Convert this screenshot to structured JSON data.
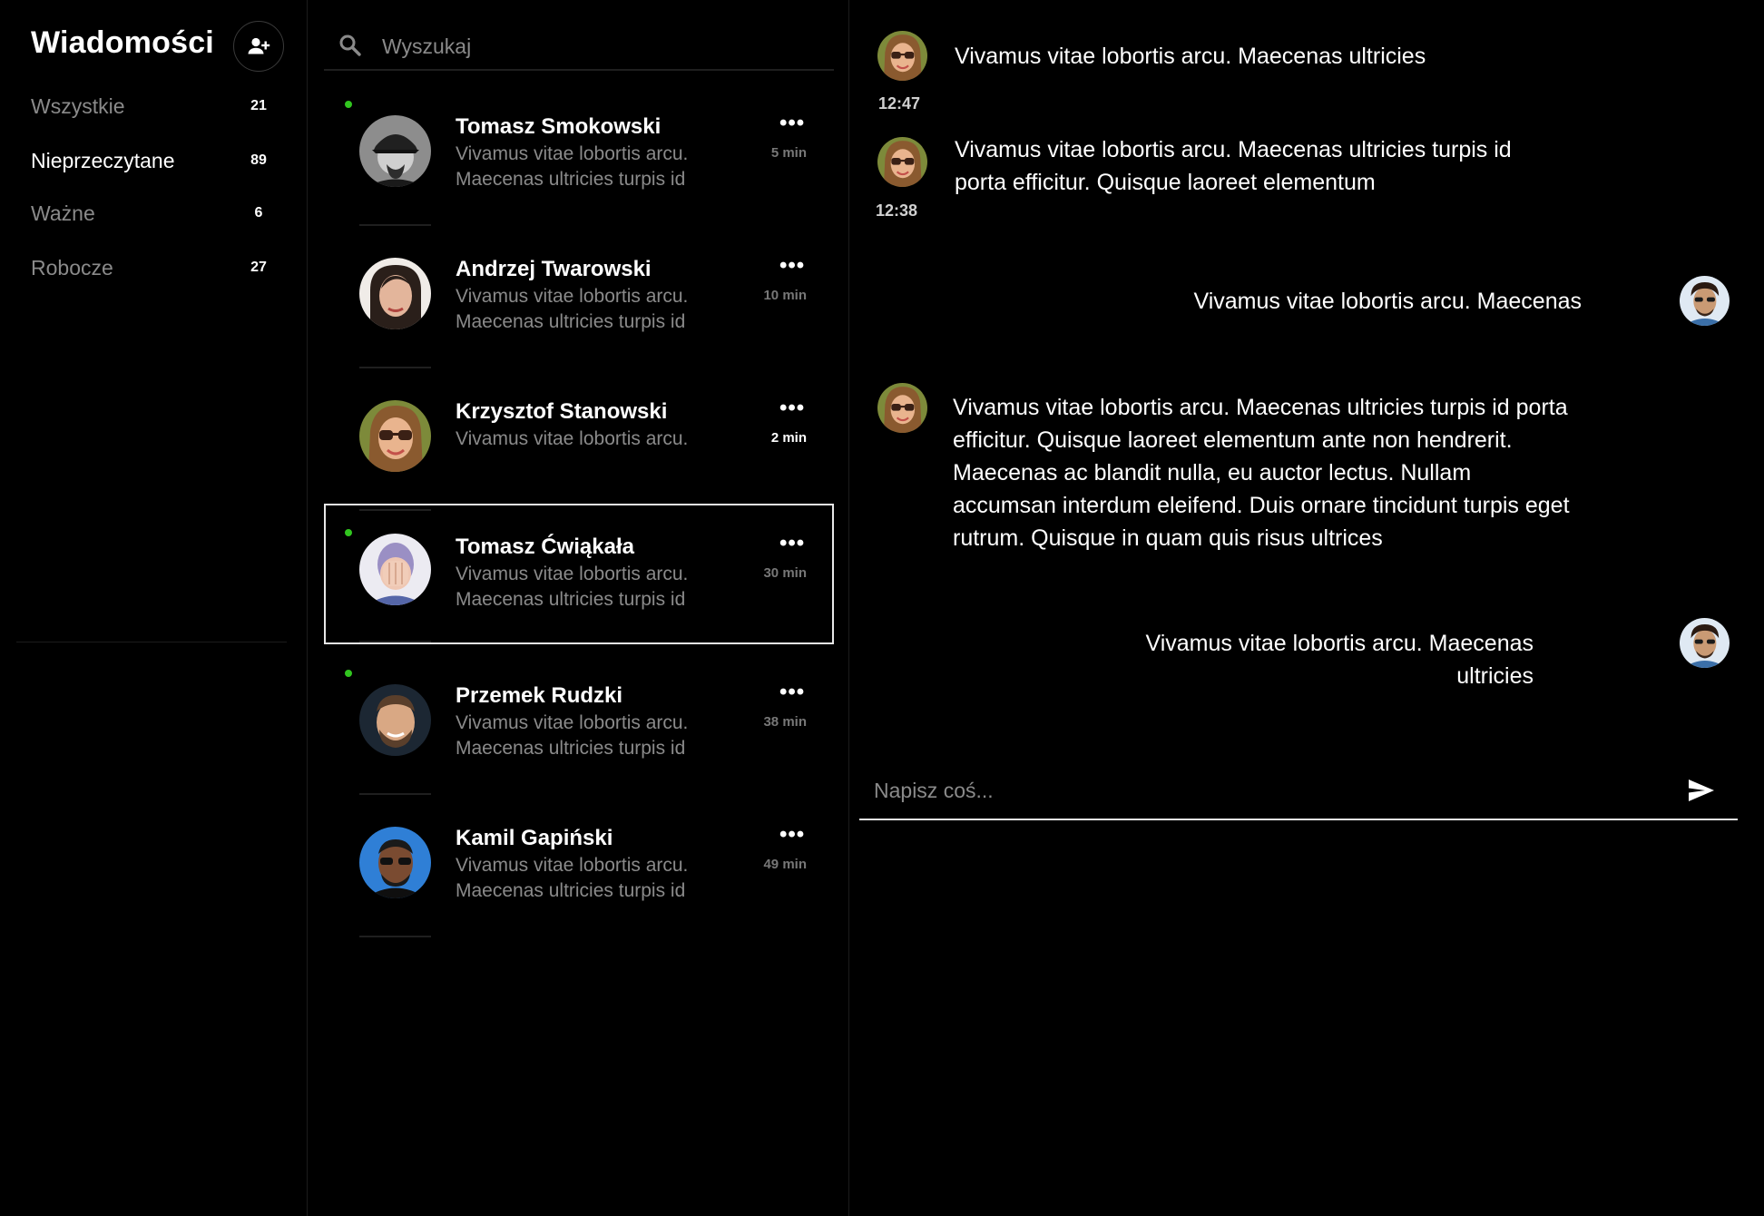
{
  "sidebar": {
    "title": "Wiadomości",
    "add_contact_icon": "person-add-icon",
    "folders": [
      {
        "label": "Wszystkie",
        "count": "21"
      },
      {
        "label": "Nieprzeczytane",
        "count": "89"
      },
      {
        "label": "Ważne",
        "count": "6"
      },
      {
        "label": "Robocze",
        "count": "27"
      }
    ]
  },
  "search": {
    "placeholder": "Wyszukaj",
    "icon": "search-icon"
  },
  "conversations": [
    {
      "name": "Tomasz Smokowski",
      "preview": "Vivamus vitae lobortis arcu. Maecenas ultricies turpis id",
      "time": "5 min",
      "online": true
    },
    {
      "name": "Andrzej Twarowski",
      "preview": "Vivamus vitae lobortis arcu. Maecenas ultricies turpis id",
      "time": "10 min",
      "online": false
    },
    {
      "name": "Krzysztof Stanowski",
      "preview": "Vivamus vitae lobortis arcu.",
      "time": "2 min",
      "online": false
    },
    {
      "name": "Tomasz Ćwiąkała",
      "preview": "Vivamus vitae lobortis arcu. Maecenas ultricies turpis id",
      "time": "30 min",
      "online": true,
      "selected": true
    },
    {
      "name": "Przemek Rudzki",
      "preview": "Vivamus vitae lobortis arcu. Maecenas ultricies turpis id",
      "time": "38 min",
      "online": true
    },
    {
      "name": "Kamil Gapiński",
      "preview": "Vivamus vitae lobortis arcu. Maecenas ultricies turpis id",
      "time": "49 min",
      "online": false
    }
  ],
  "chat": {
    "messages": [
      {
        "side": "incoming",
        "text": "Vivamus vitae lobortis arcu. Maecenas ultricies",
        "time": "12:47"
      },
      {
        "side": "incoming",
        "text": "Vivamus vitae lobortis arcu. Maecenas ultricies turpis id porta efficitur. Quisque laoreet elementum",
        "time": "12:38"
      },
      {
        "side": "outgoing",
        "text": "Vivamus vitae lobortis arcu. Maecenas"
      },
      {
        "side": "incoming",
        "text": "Vivamus vitae lobortis arcu. Maecenas ultricies turpis id porta efficitur. Quisque laoreet elementum ante non hendrerit. Maecenas ac blandit nulla, eu auctor lectus. Nullam accumsan interdum eleifend. Duis ornare tincidunt turpis eget rutrum. Quisque in quam quis risus ultrices"
      },
      {
        "side": "outgoing",
        "text": "Vivamus vitae lobortis arcu. Maecenas ultricies"
      }
    ],
    "composer": {
      "placeholder": "Napisz coś...",
      "send_icon": "send-icon"
    }
  }
}
